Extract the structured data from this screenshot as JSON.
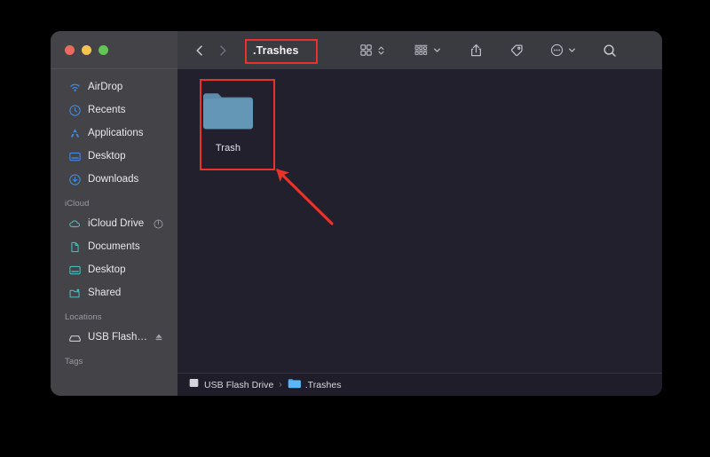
{
  "window": {
    "title": ".Trashes",
    "traffic_lights": [
      {
        "name": "close",
        "color": "#ec6a5e"
      },
      {
        "name": "minimize",
        "color": "#f5c350"
      },
      {
        "name": "maximize",
        "color": "#62c554"
      }
    ]
  },
  "toolbar": {
    "back_label": "‹",
    "forward_label": "›",
    "items": [
      {
        "name": "view-mode",
        "icon": "grid-view-icon",
        "has_chevron": true
      },
      {
        "name": "group-by",
        "icon": "group-by-icon",
        "has_chevron": true
      },
      {
        "name": "share",
        "icon": "share-icon",
        "has_chevron": false
      },
      {
        "name": "tag",
        "icon": "tag-icon",
        "has_chevron": false
      },
      {
        "name": "more-actions",
        "icon": "ellipsis-circle-icon",
        "has_chevron": true
      },
      {
        "name": "search",
        "icon": "search-icon",
        "has_chevron": false
      }
    ]
  },
  "sidebar": {
    "favorites": [
      {
        "label": "AirDrop",
        "icon": "airdrop-icon"
      },
      {
        "label": "Recents",
        "icon": "clock-icon"
      },
      {
        "label": "Applications",
        "icon": "applications-icon"
      },
      {
        "label": "Desktop",
        "icon": "desktop-icon"
      },
      {
        "label": "Downloads",
        "icon": "downloads-icon"
      }
    ],
    "icloud_title": "iCloud",
    "icloud": [
      {
        "label": "iCloud Drive",
        "icon": "cloud-icon",
        "trailing": "sync-progress-icon"
      },
      {
        "label": "Documents",
        "icon": "document-icon",
        "trailing": ""
      },
      {
        "label": "Desktop",
        "icon": "desktop-icon",
        "trailing": ""
      },
      {
        "label": "Shared",
        "icon": "shared-folder-icon",
        "trailing": ""
      }
    ],
    "locations_title": "Locations",
    "locations": [
      {
        "label": "USB Flash…",
        "icon": "external-drive-icon",
        "trailing": "eject-icon"
      }
    ],
    "tags_title": "Tags"
  },
  "content": {
    "files": [
      {
        "name": "Trash",
        "icon": "folder-icon"
      }
    ]
  },
  "statusbar": {
    "crumbs": [
      {
        "label": "USB Flash Drive",
        "icon": "drive-icon"
      },
      {
        "label": ".Trashes",
        "icon": "blue-folder-icon"
      }
    ],
    "separator": "›"
  },
  "annotations": {
    "accent_color": "#e8322a",
    "title_highlight": ".Trashes",
    "folder_highlight": "Trash",
    "arrow": "points-to-trash-folder"
  }
}
